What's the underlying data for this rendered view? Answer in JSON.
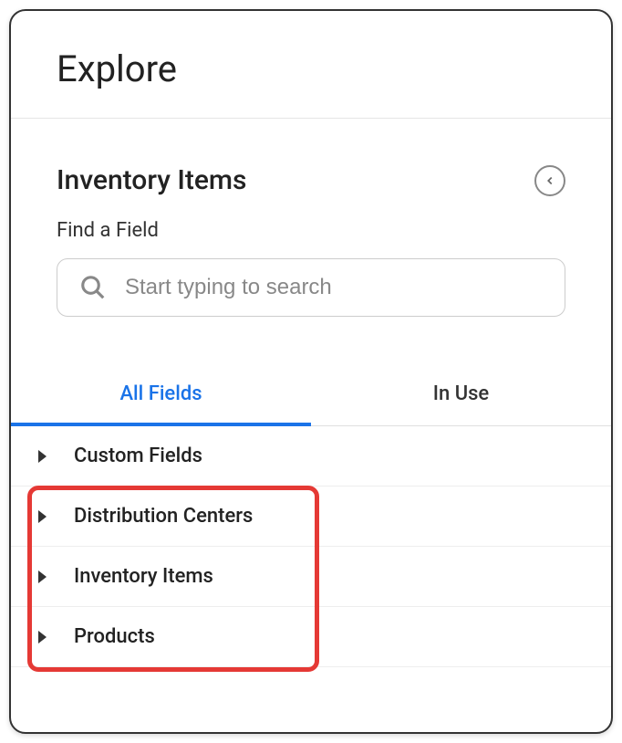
{
  "header": {
    "title": "Explore"
  },
  "section": {
    "title": "Inventory Items"
  },
  "search": {
    "label": "Find a Field",
    "placeholder": "Start typing to search"
  },
  "tabs": {
    "all_fields": "All Fields",
    "in_use": "In Use"
  },
  "fields": {
    "custom_fields": "Custom Fields",
    "distribution_centers": "Distribution Centers",
    "inventory_items": "Inventory Items",
    "products": "Products"
  }
}
